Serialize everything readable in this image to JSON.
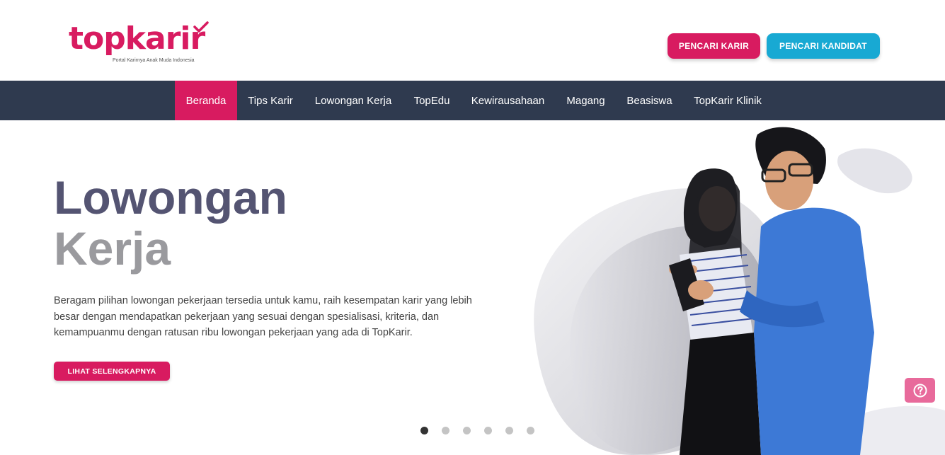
{
  "brand": {
    "logo_text": "topkarir",
    "tagline": "Portal Karirnya Anak Muda Indonesia",
    "primary_color": "#d81b60",
    "secondary_color": "#18a9d3",
    "nav_bg": "#2f3a4f"
  },
  "header": {
    "btn_pencari_karir": "PENCARI KARIR",
    "btn_pencari_kandidat": "PENCARI KANDIDAT"
  },
  "nav": {
    "active_index": 0,
    "items": [
      {
        "label": "Beranda"
      },
      {
        "label": "Tips Karir"
      },
      {
        "label": "Lowongan Kerja"
      },
      {
        "label": "TopEdu"
      },
      {
        "label": "Kewirausahaan"
      },
      {
        "label": "Magang"
      },
      {
        "label": "Beasiswa"
      },
      {
        "label": "TopKarir Klinik"
      }
    ]
  },
  "hero": {
    "title_line1": "Lowongan",
    "title_line2": "Kerja",
    "description": "Beragam pilihan lowongan pekerjaan tersedia untuk kamu, raih kesempatan karir yang lebih besar dengan mendapatkan pekerjaan yang sesuai dengan spesialisasi, kriteria, dan kemampuanmu dengan ratusan ribu lowongan pekerjaan yang ada di TopKarir.",
    "cta_label": "LIHAT SELENGKAPNYA",
    "image_icon": "two-people-looking-at-phone"
  },
  "carousel": {
    "slide_count": 6,
    "active_index": 0
  },
  "help": {
    "icon": "question-circle-icon"
  }
}
